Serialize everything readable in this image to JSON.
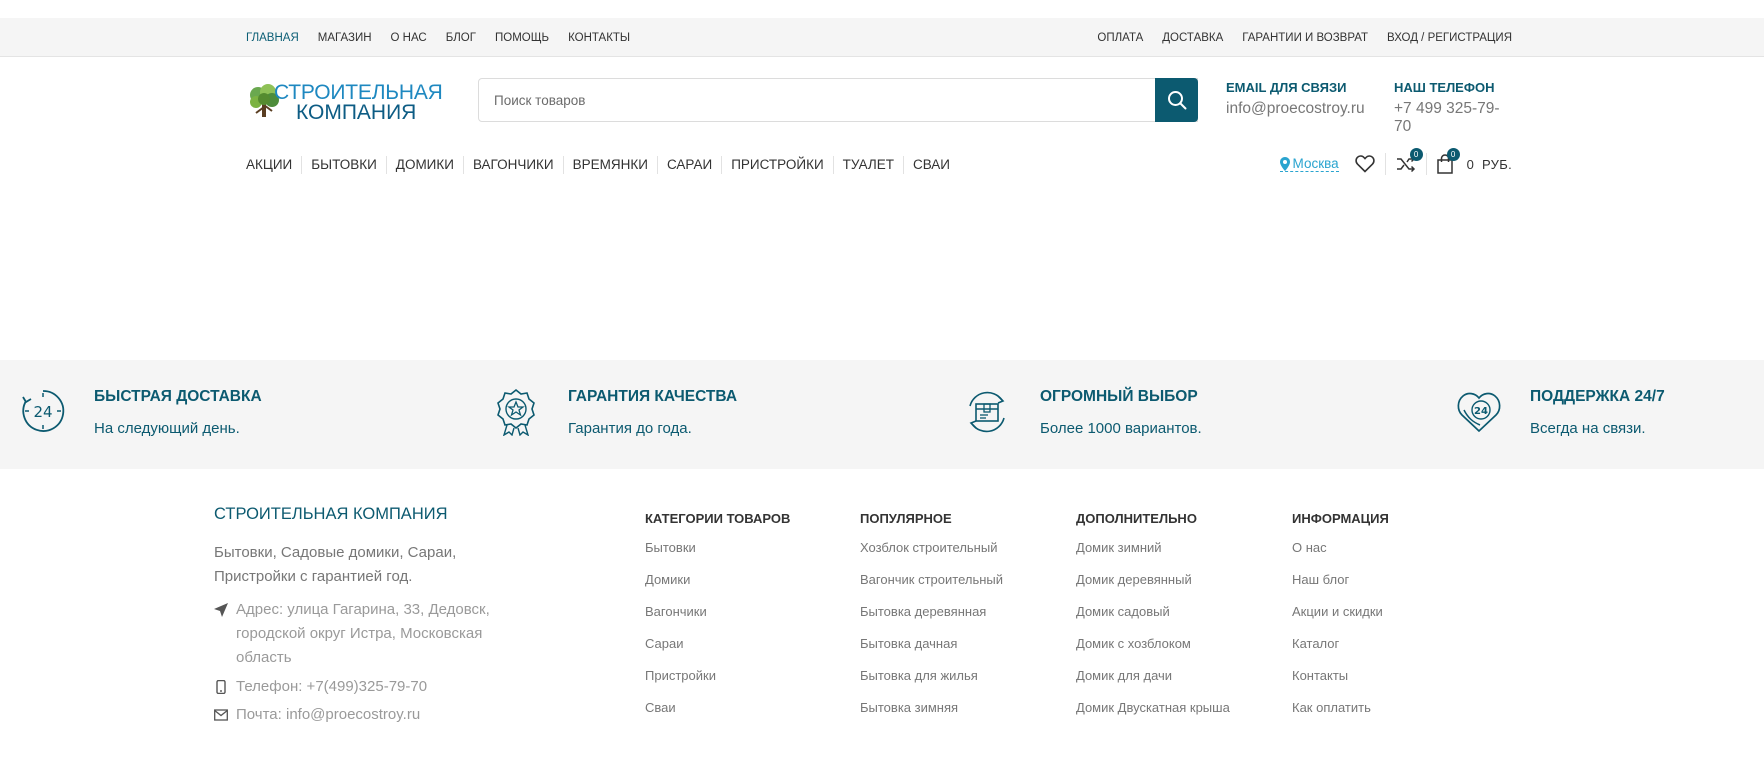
{
  "topbar": {
    "left_menu": [
      "ГЛАВНАЯ",
      "МАГАЗИН",
      "О НАС",
      "БЛОГ",
      "ПОМОЩЬ",
      "КОНТАКТЫ"
    ],
    "right_menu": [
      "ОПЛАТА",
      "ДОСТАВКА",
      "ГАРАНТИИ И ВОЗВРАТ",
      "ВХОД / РЕГИСТРАЦИЯ"
    ]
  },
  "header": {
    "logo_line1": "СТРОИТЕЛЬНАЯ",
    "logo_line2": "КОМПАНИЯ",
    "search_placeholder": "Поиск товаров",
    "email_label": "EMAIL ДЛЯ СВЯЗИ",
    "email_value": "info@proecostroy.ru",
    "phone_label": "НАШ ТЕЛЕФОН",
    "phone_value": "+7 499 325-79-70"
  },
  "nav": {
    "categories": [
      "АКЦИИ",
      "БЫТОВКИ",
      "ДОМИКИ",
      "ВАГОНЧИКИ",
      "ВРЕМЯНКИ",
      "САРАИ",
      "ПРИСТРОЙКИ",
      "ТУАЛЕТ",
      "СВАИ"
    ],
    "city": "Москва",
    "compare_count": "0",
    "cart_count": "0",
    "cart_total": "0",
    "currency": "РУБ."
  },
  "features": [
    {
      "icon": "clock-24-icon",
      "title": "БЫСТРАЯ ДОСТАВКА",
      "subtitle": "На следующий день."
    },
    {
      "icon": "quality-badge-icon",
      "title": "ГАРАНТИЯ КАЧЕСТВА",
      "subtitle": "Гарантия до года."
    },
    {
      "icon": "box-cycle-icon",
      "title": "ОГРОМНЫЙ ВЫБОР",
      "subtitle": "Более 1000 вариантов."
    },
    {
      "icon": "support-24-icon",
      "title": "ПОДДЕРЖКА 24/7",
      "subtitle": "Всегда на связи."
    }
  ],
  "footer": {
    "company_title": "СТРОИТЕЛЬНАЯ КОМПАНИЯ",
    "company_desc": "Бытовки, Садовые домики, Сараи, Пристройки с гарантией год.",
    "address": "Адрес: улица Гагарина, 33, Дедовск, городской округ Истра, Московская область",
    "phone": "Телефон: +7(499)325-79-70",
    "email": "Почта: info@proecostroy.ru",
    "columns": [
      {
        "title": "КАТЕГОРИИ ТОВАРОВ",
        "items": [
          "Бытовки",
          "Домики",
          "Вагончики",
          "Сараи",
          "Пристройки",
          "Сваи"
        ]
      },
      {
        "title": "ПОПУЛЯРНОЕ",
        "items": [
          "Хозблок строительный",
          "Вагончик строительный",
          "Бытовка деревянная",
          "Бытовка дачная",
          "Бытовка для жилья",
          "Бытовка зимняя"
        ]
      },
      {
        "title": "ДОПОЛНИТЕЛЬНО",
        "items": [
          "Домик зимний",
          "Домик деревянный",
          "Домик садовый",
          "Домик с хозблоком",
          "Домик для дачи",
          "Домик Двускатная крыша"
        ]
      },
      {
        "title": "ИНФОРМАЦИЯ",
        "items": [
          "О нас",
          "Наш блог",
          "Акции и скидки",
          "Каталог",
          "Контакты",
          "Как оплатить"
        ]
      }
    ]
  },
  "colors": {
    "primary": "#0c5a70",
    "accent": "#2aa4cf",
    "band": "#f5f5f5"
  }
}
